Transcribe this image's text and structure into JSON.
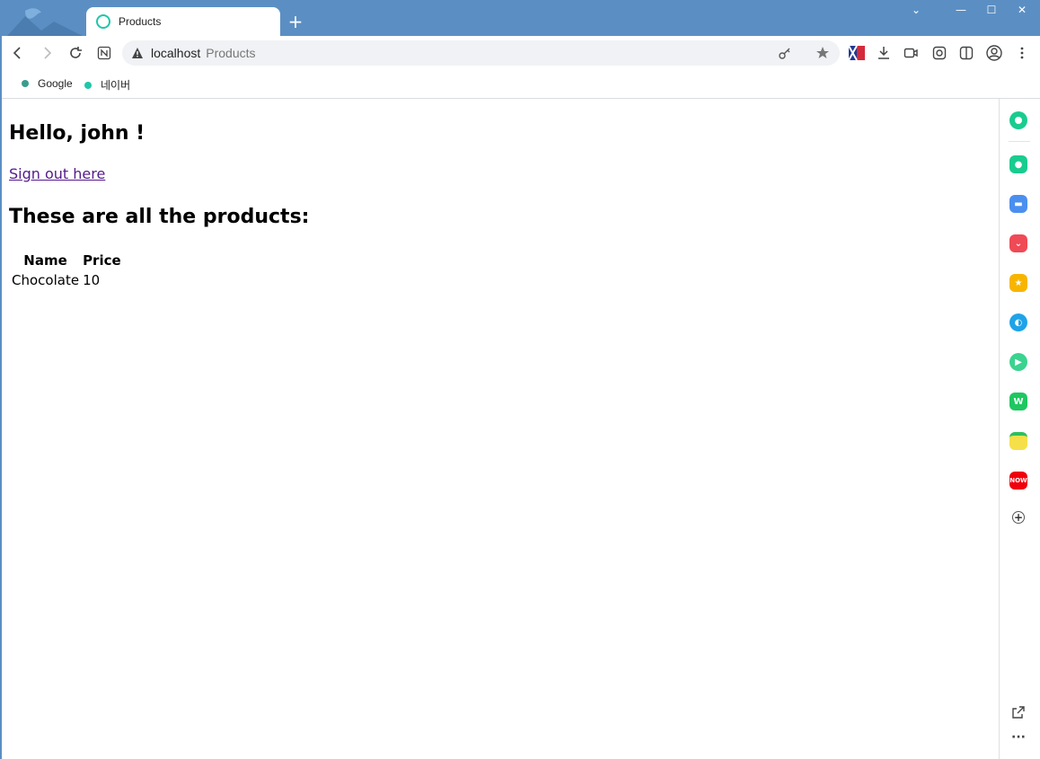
{
  "browser": {
    "tab_title": "Products",
    "new_tab_label": "+",
    "address_host": "localhost",
    "address_title": "Products",
    "bookmarks": [
      {
        "label": "Google",
        "color": "#3a9c8e"
      },
      {
        "label": "네이버",
        "color": "#1fc7a8"
      }
    ]
  },
  "page": {
    "greeting": "Hello, john !",
    "signout_link": "Sign out here",
    "products_heading": "These are all the products:",
    "table": {
      "headers": [
        "Name",
        "Price"
      ],
      "rows": [
        [
          "Chocolate",
          "10"
        ]
      ]
    }
  },
  "sidebar": {
    "items": [
      {
        "name": "whale-icon",
        "color": "#19cc8f"
      },
      {
        "name": "notification-icon",
        "color": "#19cc8f"
      },
      {
        "name": "briefcase-icon",
        "color": "#4a8ff0"
      },
      {
        "name": "pocket-icon",
        "color": "#ef4a56"
      },
      {
        "name": "star-icon",
        "color": "#f7b500"
      },
      {
        "name": "papago-icon",
        "color": "#1fa3e8"
      },
      {
        "name": "play-icon",
        "color": "#3ad38f"
      },
      {
        "name": "webtoon-icon",
        "color": "#1ec760"
      },
      {
        "name": "memo-icon",
        "color": "#f5e04a"
      },
      {
        "name": "now-icon",
        "color": "#f0000c"
      }
    ]
  }
}
